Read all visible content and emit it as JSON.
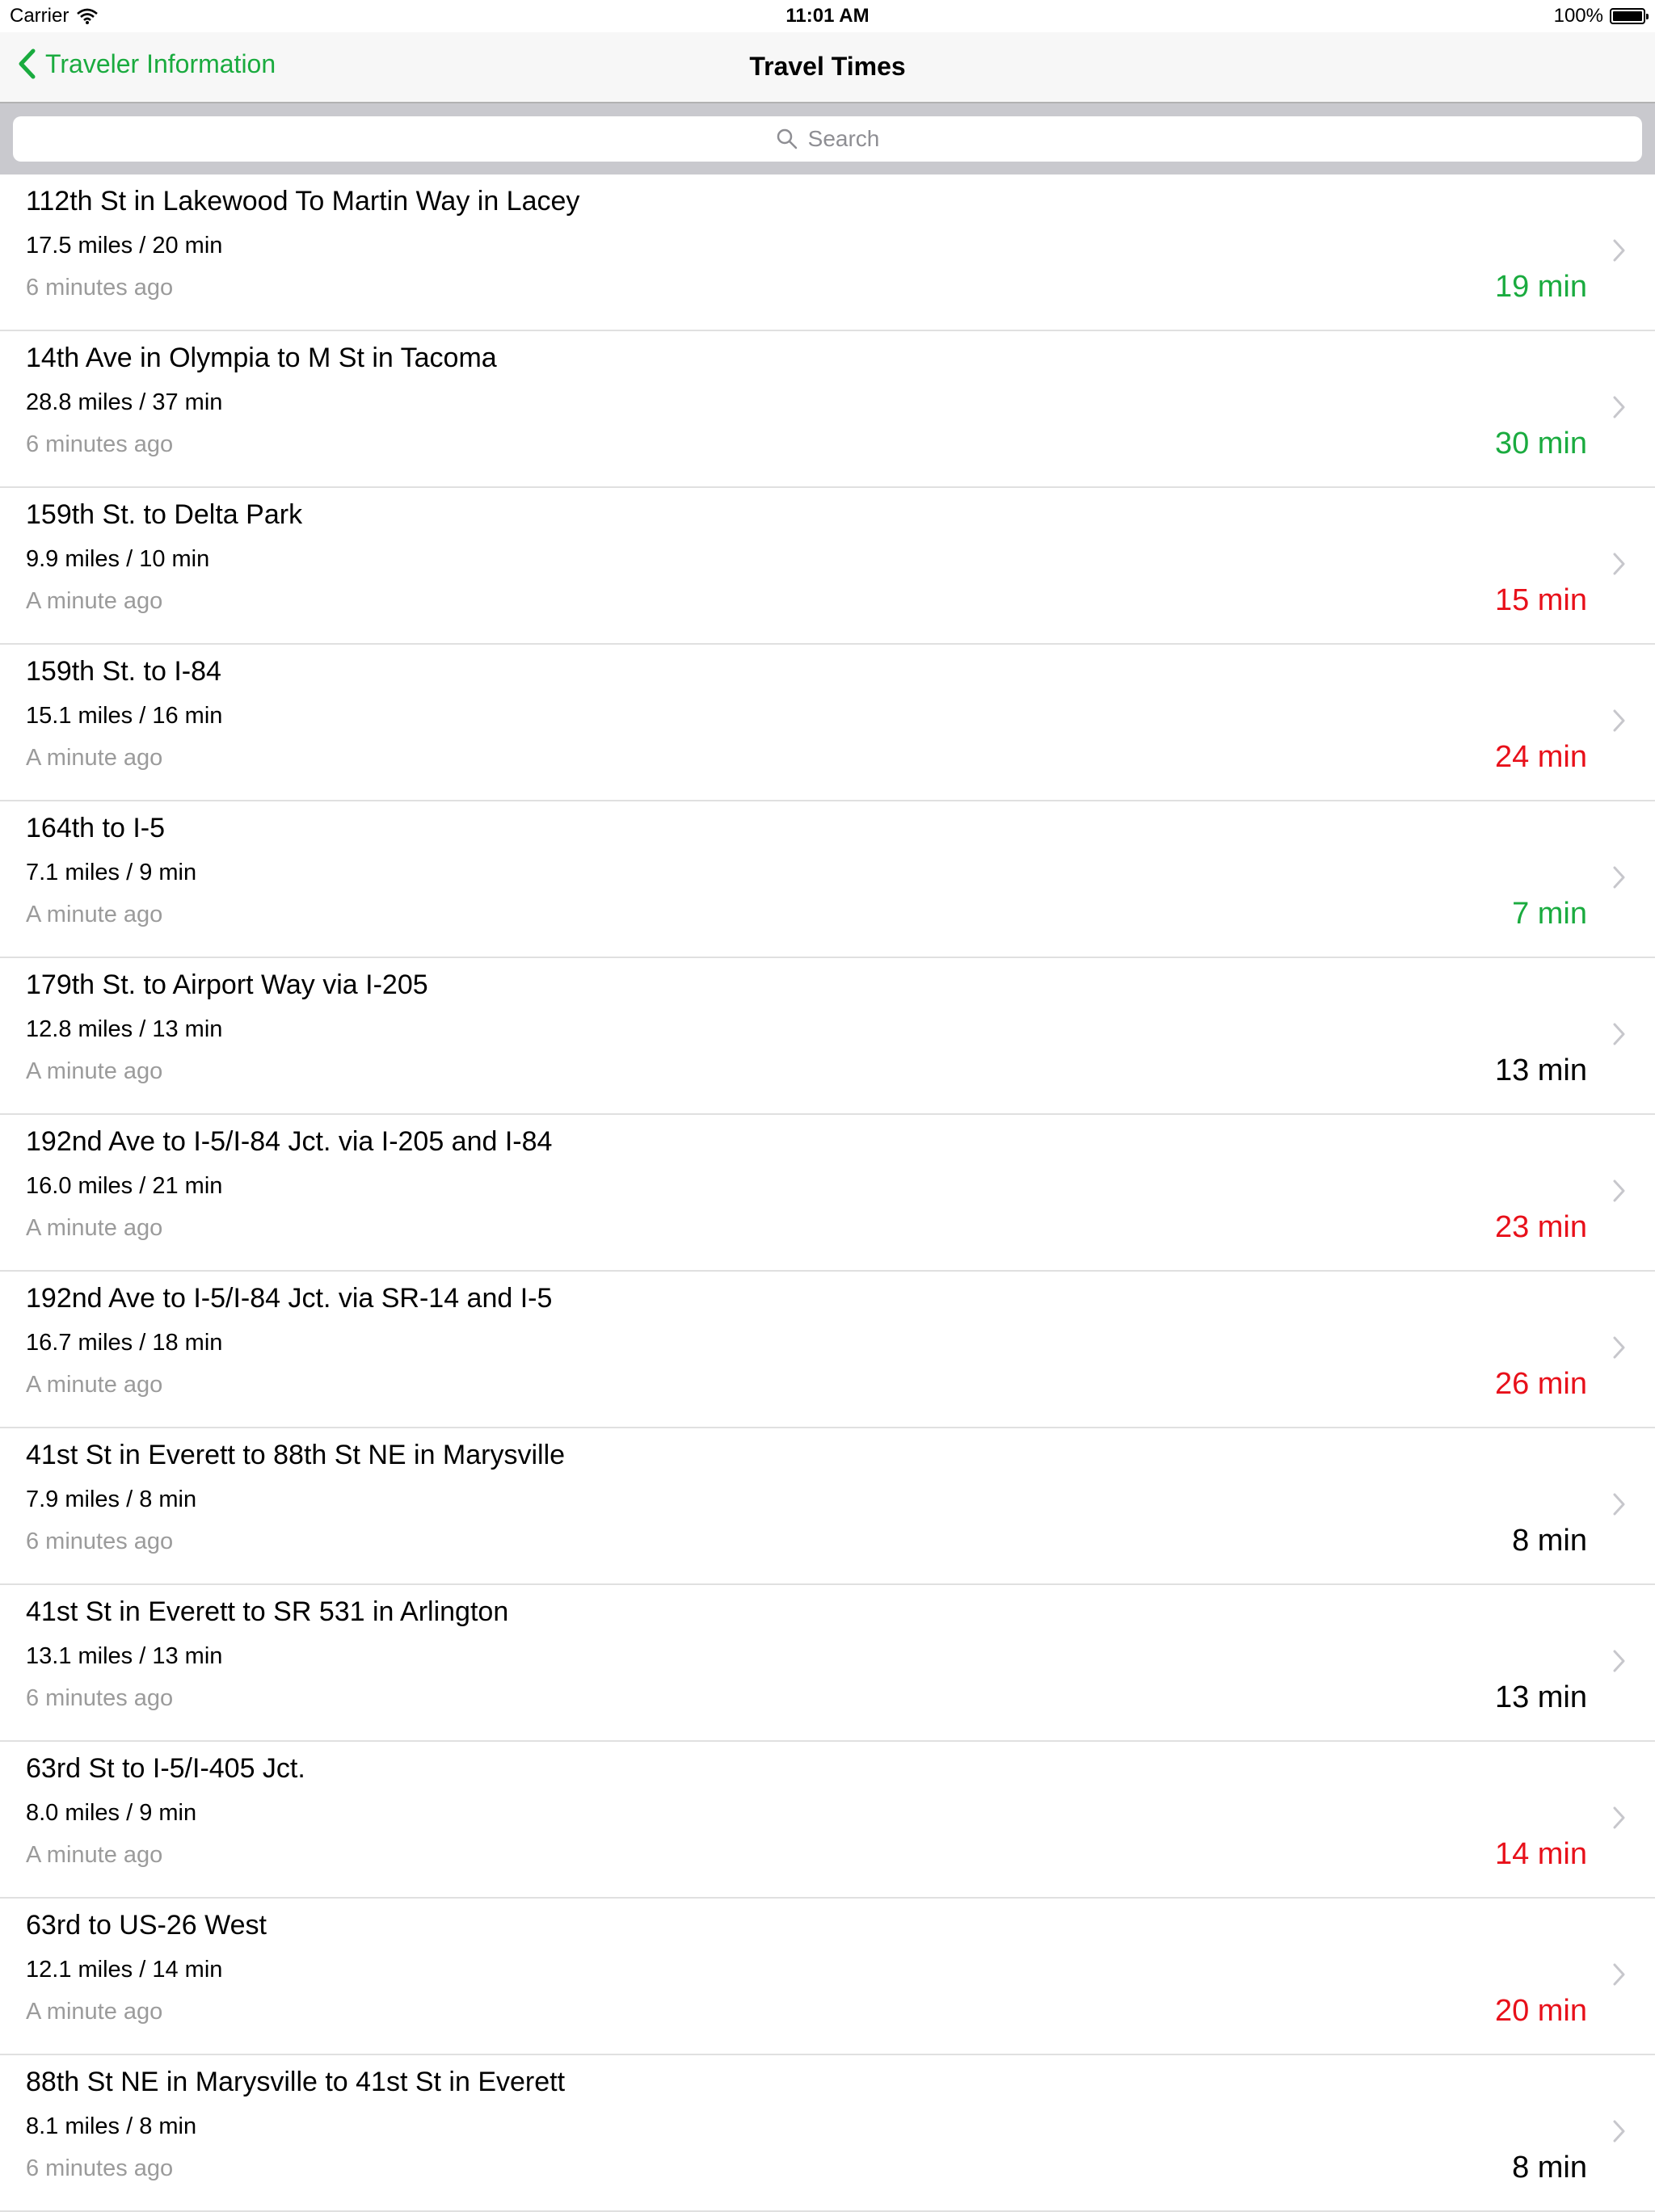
{
  "status": {
    "carrier": "Carrier",
    "time": "11:01 AM",
    "battery": "100%"
  },
  "nav": {
    "back_label": "Traveler Information",
    "title": "Travel Times"
  },
  "search": {
    "placeholder": "Search"
  },
  "colors": {
    "accent": "#1aab3f",
    "good": "#1aab3f",
    "slow": "#e8101a",
    "normal": "#000000"
  },
  "routes": [
    {
      "title": "112th St in Lakewood To Martin Way in Lacey",
      "distance": "17.5 miles / 20 min",
      "updated": "6 minutes ago",
      "current": "19 min",
      "status": "good"
    },
    {
      "title": "14th Ave in Olympia to M St in Tacoma",
      "distance": "28.8 miles / 37 min",
      "updated": "6 minutes ago",
      "current": "30 min",
      "status": "good"
    },
    {
      "title": "159th St. to Delta Park",
      "distance": "9.9 miles / 10 min",
      "updated": "A minute ago",
      "current": "15 min",
      "status": "slow"
    },
    {
      "title": "159th St. to I-84",
      "distance": "15.1 miles / 16 min",
      "updated": "A minute ago",
      "current": "24 min",
      "status": "slow"
    },
    {
      "title": "164th to I-5",
      "distance": "7.1 miles / 9 min",
      "updated": "A minute ago",
      "current": "7 min",
      "status": "good"
    },
    {
      "title": "179th St. to Airport Way via I-205",
      "distance": "12.8 miles / 13 min",
      "updated": "A minute ago",
      "current": "13 min",
      "status": "normal"
    },
    {
      "title": "192nd Ave to I-5/I-84 Jct. via I-205 and I-84",
      "distance": "16.0 miles / 21 min",
      "updated": "A minute ago",
      "current": "23 min",
      "status": "slow"
    },
    {
      "title": "192nd Ave to I-5/I-84 Jct. via SR-14 and I-5",
      "distance": "16.7 miles / 18 min",
      "updated": "A minute ago",
      "current": "26 min",
      "status": "slow"
    },
    {
      "title": "41st St in Everett to 88th St NE in Marysville",
      "distance": "7.9 miles / 8 min",
      "updated": "6 minutes ago",
      "current": "8 min",
      "status": "normal"
    },
    {
      "title": "41st St in Everett to SR 531 in Arlington",
      "distance": "13.1 miles / 13 min",
      "updated": "6 minutes ago",
      "current": "13 min",
      "status": "normal"
    },
    {
      "title": "63rd St to I-5/I-405 Jct.",
      "distance": "8.0 miles / 9 min",
      "updated": "A minute ago",
      "current": "14 min",
      "status": "slow"
    },
    {
      "title": "63rd to US-26 West",
      "distance": "12.1 miles / 14 min",
      "updated": "A minute ago",
      "current": "20 min",
      "status": "slow"
    },
    {
      "title": "88th St NE in Marysville to 41st St in Everett",
      "distance": "8.1 miles / 8 min",
      "updated": "6 minutes ago",
      "current": "8 min",
      "status": "normal"
    }
  ]
}
